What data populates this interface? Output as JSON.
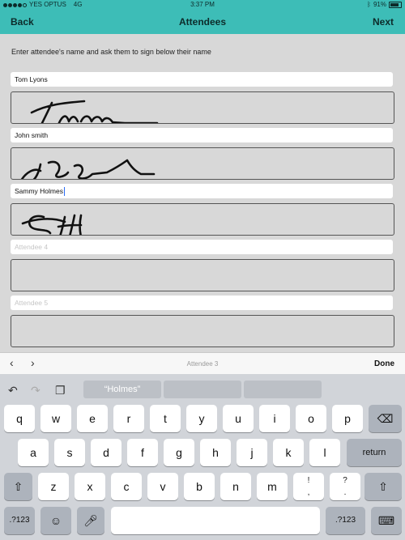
{
  "status_bar": {
    "carrier": "YES OPTUS",
    "network": "4G",
    "time": "3:37 PM",
    "battery": "91%",
    "bluetooth_icon": "bluetooth-icon"
  },
  "nav": {
    "back": "Back",
    "title": "Attendees",
    "next": "Next"
  },
  "instructions": "Enter attendee's name and ask them to sign below their name",
  "attendees": [
    {
      "value": "Tom Lyons",
      "placeholder": ""
    },
    {
      "value": "John smith",
      "placeholder": ""
    },
    {
      "value": "Sammy Holmes",
      "placeholder": ""
    },
    {
      "value": "",
      "placeholder": "Attendee 4"
    },
    {
      "value": "",
      "placeholder": "Attendee 5"
    }
  ],
  "accessory": {
    "current_field": "Attendee 3",
    "done": "Done"
  },
  "keyboard": {
    "suggestions": [
      "“Holmes”",
      "",
      ""
    ],
    "row1": [
      "q",
      "w",
      "e",
      "r",
      "t",
      "y",
      "u",
      "i",
      "o",
      "p"
    ],
    "row2": [
      "a",
      "s",
      "d",
      "f",
      "g",
      "h",
      "j",
      "k",
      "l"
    ],
    "row3": [
      "z",
      "x",
      "c",
      "v",
      "b",
      "n",
      "m"
    ],
    "return_label": "return",
    "numbers_label": ".?123",
    "punct1_top": "!",
    "punct1_bottom": ",",
    "punct2_top": "?",
    "punct2_bottom": ".",
    "colors": {
      "accent": "#3dbdb7",
      "keyboard_bg": "#d1d4d9",
      "key_bg": "#ffffff",
      "key_dark": "#adb3bc"
    }
  }
}
